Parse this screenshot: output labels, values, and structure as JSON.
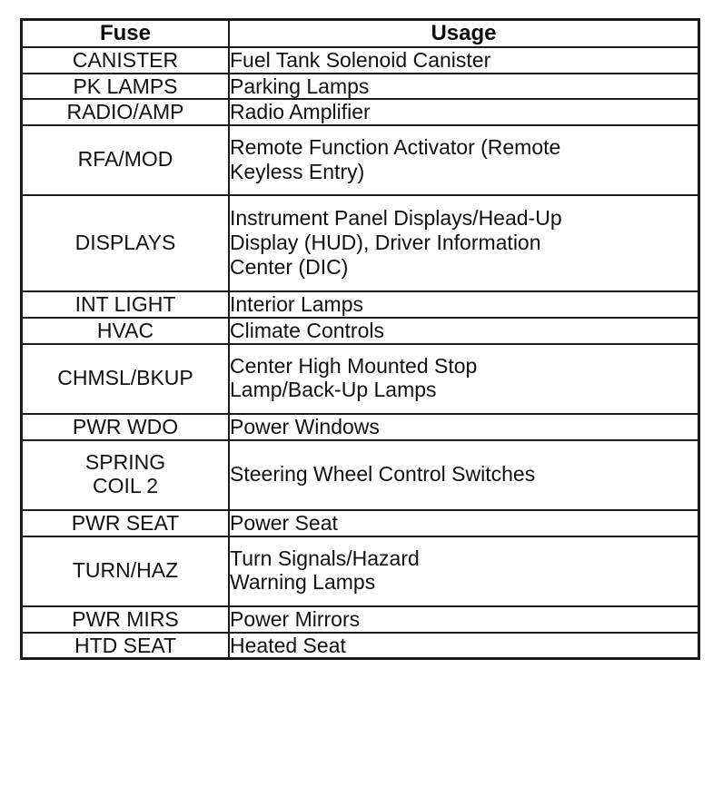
{
  "table": {
    "columns": [
      {
        "key": "fuse",
        "label": "Fuse"
      },
      {
        "key": "usage",
        "label": "Usage"
      }
    ],
    "rows": [
      {
        "fuse": "CANISTER",
        "usage": "Fuel Tank Solenoid Canister"
      },
      {
        "fuse": "PK LAMPS",
        "usage": "Parking Lamps"
      },
      {
        "fuse": "RADIO/AMP",
        "usage": "Radio Amplifier"
      },
      {
        "fuse": "RFA/MOD",
        "usage": "Remote Function Activator (Remote\nKeyless Entry)"
      },
      {
        "fuse": "DISPLAYS",
        "usage": "Instrument Panel Displays/Head-Up\nDisplay (HUD), Driver Information\nCenter (DIC)"
      },
      {
        "fuse": "INT LIGHT",
        "usage": "Interior Lamps"
      },
      {
        "fuse": "HVAC",
        "usage": "Climate Controls"
      },
      {
        "fuse": "CHMSL/BKUP",
        "usage": "Center High Mounted Stop\nLamp/Back-Up Lamps"
      },
      {
        "fuse": "PWR WDO",
        "usage": "Power Windows"
      },
      {
        "fuse": "SPRING\nCOIL 2",
        "usage": "Steering Wheel Control Switches"
      },
      {
        "fuse": "PWR SEAT",
        "usage": "Power Seat"
      },
      {
        "fuse": "TURN/HAZ",
        "usage": "Turn Signals/Hazard\nWarning Lamps"
      },
      {
        "fuse": "PWR MIRS",
        "usage": "Power Mirrors"
      },
      {
        "fuse": "HTD SEAT",
        "usage": "Heated Seat"
      }
    ]
  },
  "colors": {
    "border": "#1a1a1a",
    "text": "#111111",
    "background": "#ffffff"
  }
}
